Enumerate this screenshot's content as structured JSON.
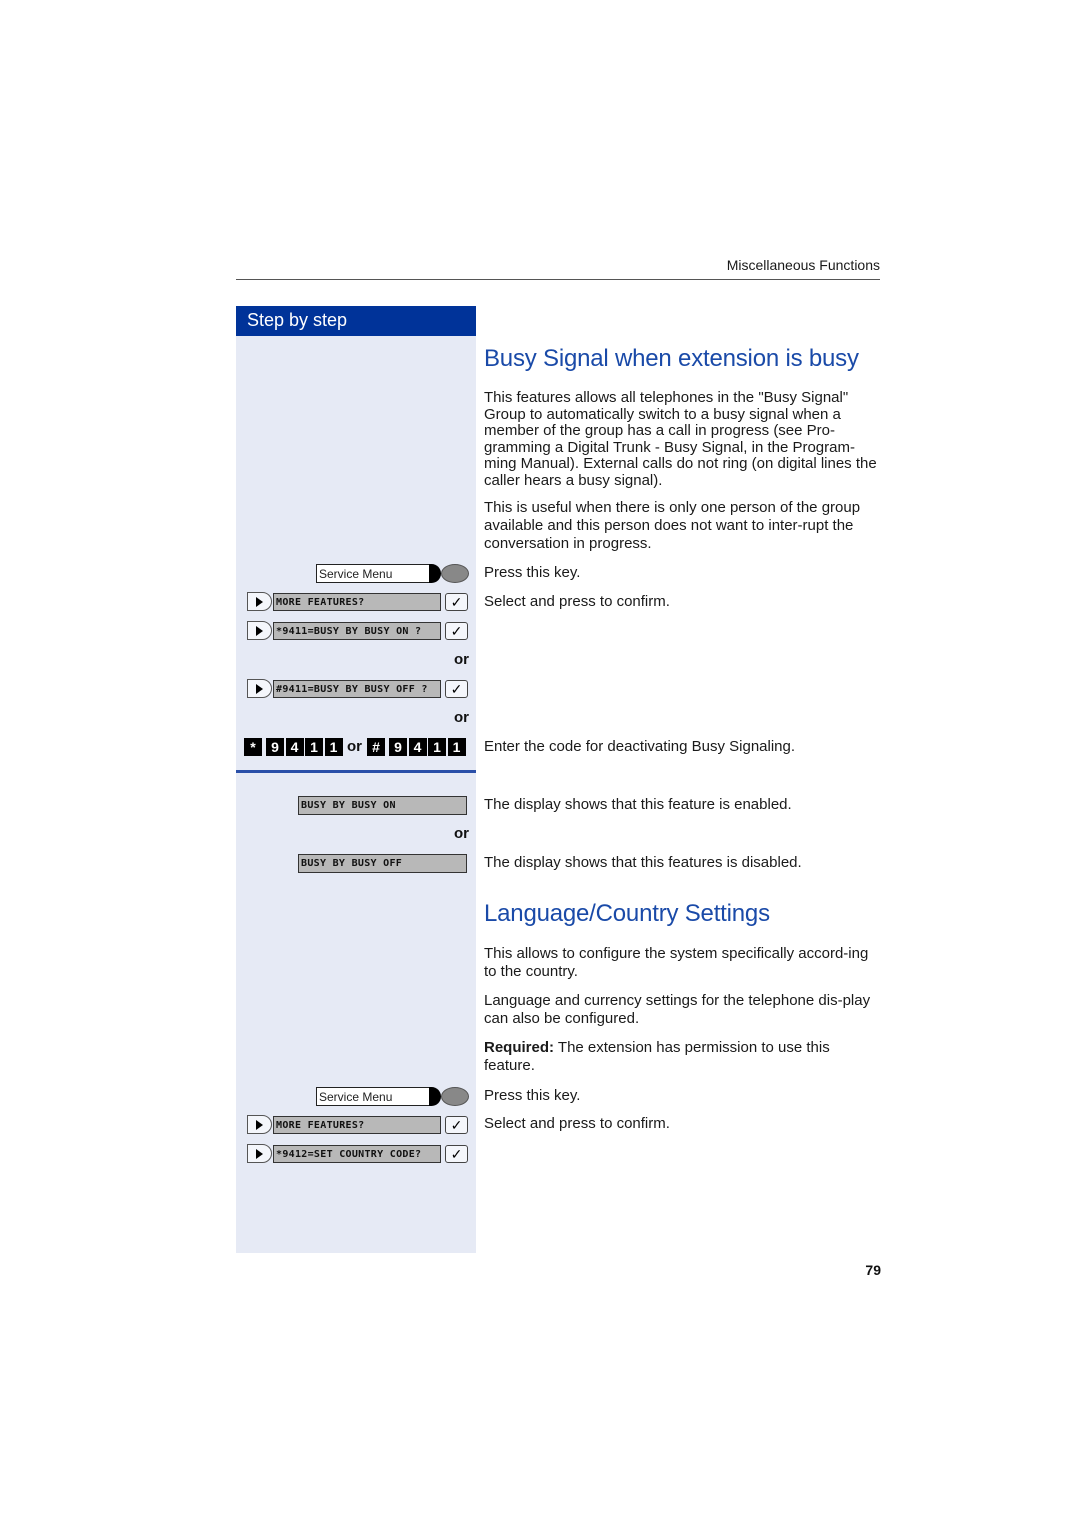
{
  "header": {
    "section": "Miscellaneous Functions"
  },
  "sidebar": {
    "title": "Step by step"
  },
  "section1": {
    "title": "Busy Signal when extension is busy",
    "para1": "This features allows all telephones in the \"Busy Signal\" Group to automatically switch to a busy signal when a member of the group has a call in progress (see Pro-gramming a Digital Trunk - Busy Signal, in the Program-ming Manual). External calls do not ring (on digital lines the caller hears a busy signal).",
    "para2": "This is useful when there is only one person of the group available and this person does not want to inter-rupt the conversation in progress.",
    "steps": [
      {
        "key": "Service Menu",
        "text": "Press this key."
      },
      {
        "display": "MORE FEATURES?",
        "text": "Select and press to confirm."
      },
      {
        "display": "*9411=BUSY BY BUSY ON ?"
      },
      {
        "display": "#9411=BUSY BY BUSY OFF ?"
      }
    ],
    "or": "or",
    "code_on": [
      "*",
      "9",
      "4",
      "1",
      "1"
    ],
    "code_off": [
      "#",
      "9",
      "4",
      "1",
      "1"
    ],
    "code_text": "Enter the code for deactivating Busy Signaling.",
    "result_on": {
      "display": "BUSY BY BUSY ON",
      "text": "The display shows that this feature is enabled."
    },
    "result_off": {
      "display": "BUSY BY BUSY OFF",
      "text": "The display shows that this features is disabled."
    }
  },
  "section2": {
    "title": "Language/Country Settings",
    "para1": "This allows to configure the system specifically accord-ing to the country.",
    "para2": "Language and currency settings for the telephone dis-play can also be configured.",
    "required_label": "Required:",
    "required_text": " The extension has permission to use this feature.",
    "steps": [
      {
        "key": "Service Menu",
        "text": "Press this key."
      },
      {
        "display": "MORE FEATURES?",
        "text": "Select and press to confirm."
      },
      {
        "display": "*9412=SET COUNTRY CODE?"
      }
    ]
  },
  "check_glyph": "✓",
  "page_number": "79"
}
